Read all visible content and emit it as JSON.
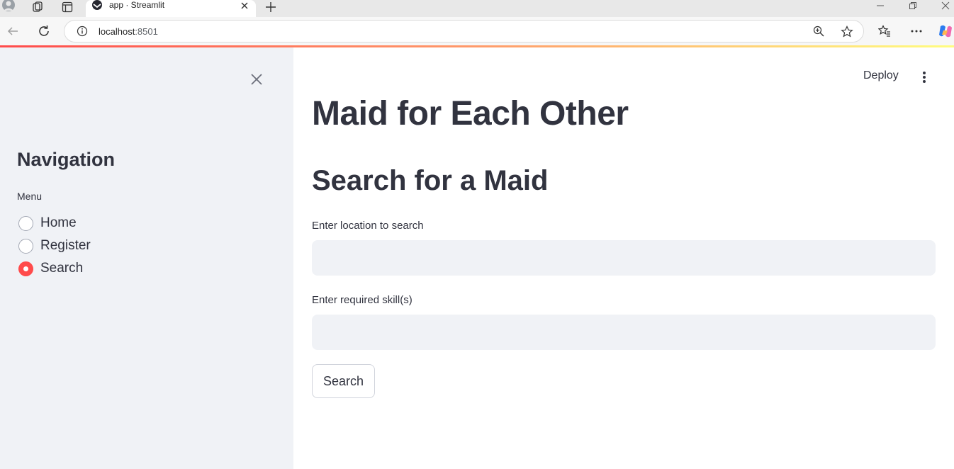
{
  "browser": {
    "tab_title": "app · Streamlit",
    "url_host": "localhost",
    "url_port": ":8501"
  },
  "sidebar": {
    "title": "Navigation",
    "menu_label": "Menu",
    "options": [
      {
        "label": "Home",
        "selected": false
      },
      {
        "label": "Register",
        "selected": false
      },
      {
        "label": "Search",
        "selected": true
      }
    ]
  },
  "header": {
    "deploy_label": "Deploy"
  },
  "main": {
    "title": "Maid for Each Other",
    "subtitle": "Search for a Maid",
    "location_label": "Enter location to search",
    "location_value": "",
    "skills_label": "Enter required skill(s)",
    "skills_value": "",
    "search_button": "Search"
  },
  "colors": {
    "accent": "#ff4b4b",
    "sidebar_bg": "#f0f2f6",
    "text": "#31333f"
  }
}
